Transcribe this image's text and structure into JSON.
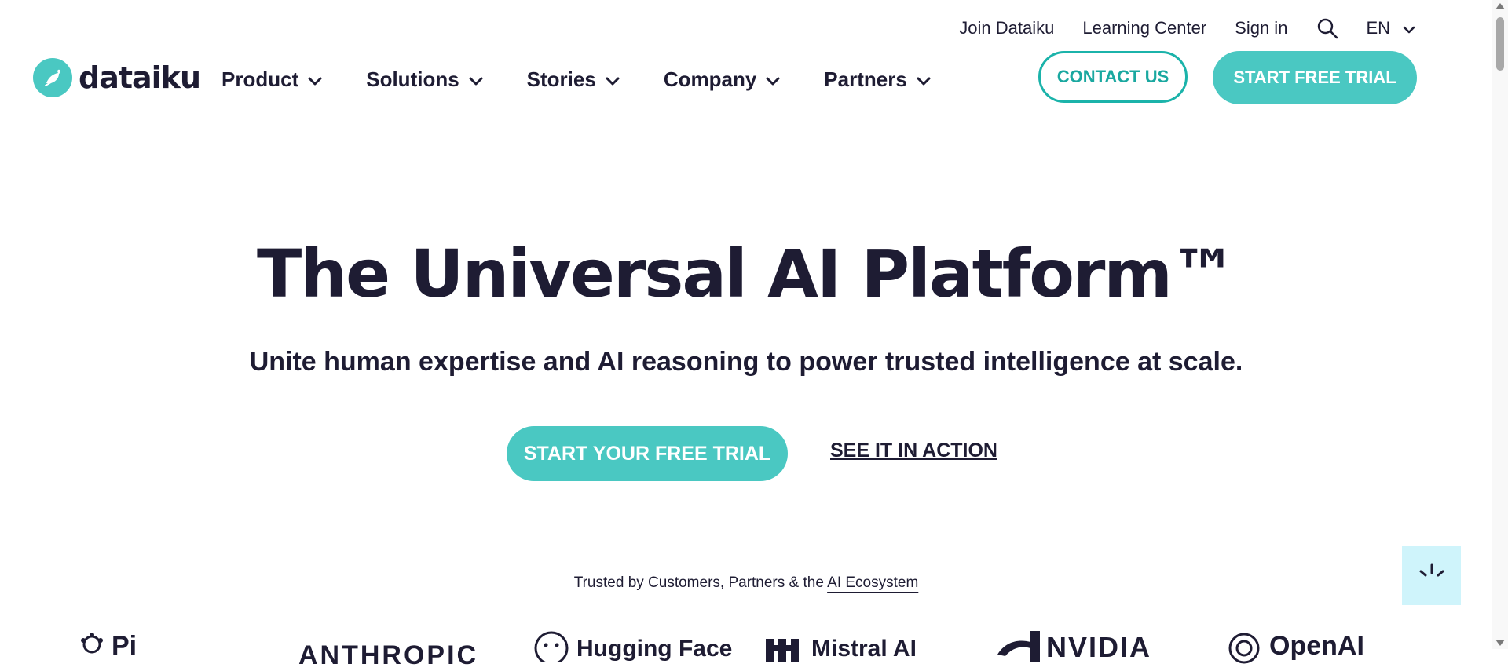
{
  "colors": {
    "brand_teal": "#4ac8c2",
    "outline_teal": "#1bb3aa",
    "text_dark": "#1e1c33",
    "chat_bg": "#cff4fb"
  },
  "utility_nav": {
    "items": [
      "Join Dataiku",
      "Learning Center",
      "Sign in"
    ],
    "search_icon": "search-icon",
    "language": "EN"
  },
  "brand": {
    "name": "dataiku",
    "icon": "bird-icon"
  },
  "main_nav": {
    "items": [
      {
        "label": "Product"
      },
      {
        "label": "Solutions"
      },
      {
        "label": "Stories"
      },
      {
        "label": "Company"
      },
      {
        "label": "Partners"
      }
    ],
    "contact_label": "CONTACT US",
    "trial_label": "START FREE TRIAL"
  },
  "hero": {
    "title": "The Universal AI Platform™",
    "subtitle": "Unite human expertise and AI reasoning to power trusted intelligence at scale.",
    "primary_cta": "START YOUR FREE TRIAL",
    "secondary_cta": "SEE IT IN ACTION"
  },
  "trusted": {
    "prefix": "Trusted by Customers, Partners & the ",
    "link": "AI Ecosystem"
  },
  "partner_logos": [
    "Pi",
    "ANTHROPIC",
    "Hugging Face",
    "Mistral AI",
    "NVIDIA",
    "OpenAI"
  ],
  "chat_widget": {
    "icon": "loading-spinner-icon"
  }
}
